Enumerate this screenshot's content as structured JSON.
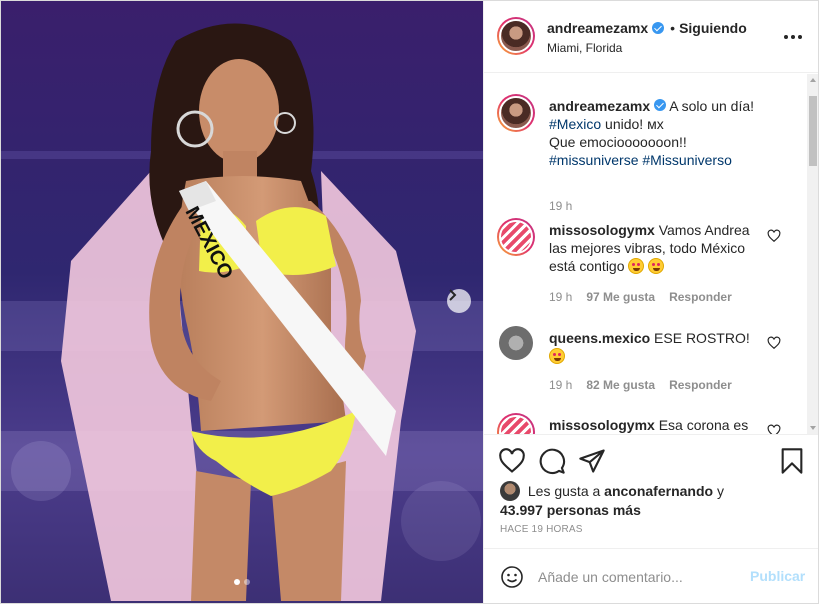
{
  "post": {
    "username": "andreamezamx",
    "separator": "•",
    "follow_status": "Siguiendo",
    "location": "Miami, Florida",
    "sash_text": "MEXICO",
    "carousel": {
      "slides": 2,
      "active": 1
    }
  },
  "caption": {
    "username": "andreamezamx",
    "text_1": "A solo un día!",
    "hashtag_mexico": "#Mexico",
    "text_2": "unido! мх",
    "text_3": "Que emociooooooon!!",
    "hashtag_missuniverse": "#missuniverse",
    "hashtag_missuniverso": "#Missuniverso",
    "time": "19 h"
  },
  "comments": [
    {
      "username": "missosologymx",
      "text": "Vamos Andrea las mejores vibras, todo México está contigo",
      "time": "19 h",
      "likes": "97 Me gusta",
      "reply": "Responder"
    },
    {
      "username": "queens.mexico",
      "text": "ESE ROSTRO!",
      "time": "19 h",
      "likes": "82 Me gusta",
      "reply": "Responder"
    },
    {
      "username": "missosologymx",
      "text": "Esa corona es"
    }
  ],
  "likes_summary": {
    "prefix": "Les gusta a",
    "user": "anconafernando",
    "conjunction": "y",
    "others": "43.997 personas más"
  },
  "timestamp": "Hace 19 horas",
  "composer": {
    "placeholder": "Añade un comentario...",
    "publish_label": "Publicar"
  },
  "colors": {
    "link": "#00376b",
    "verified": "#3897f0",
    "publish_disabled": "#b2dffc",
    "muted": "#8e8e8e"
  }
}
